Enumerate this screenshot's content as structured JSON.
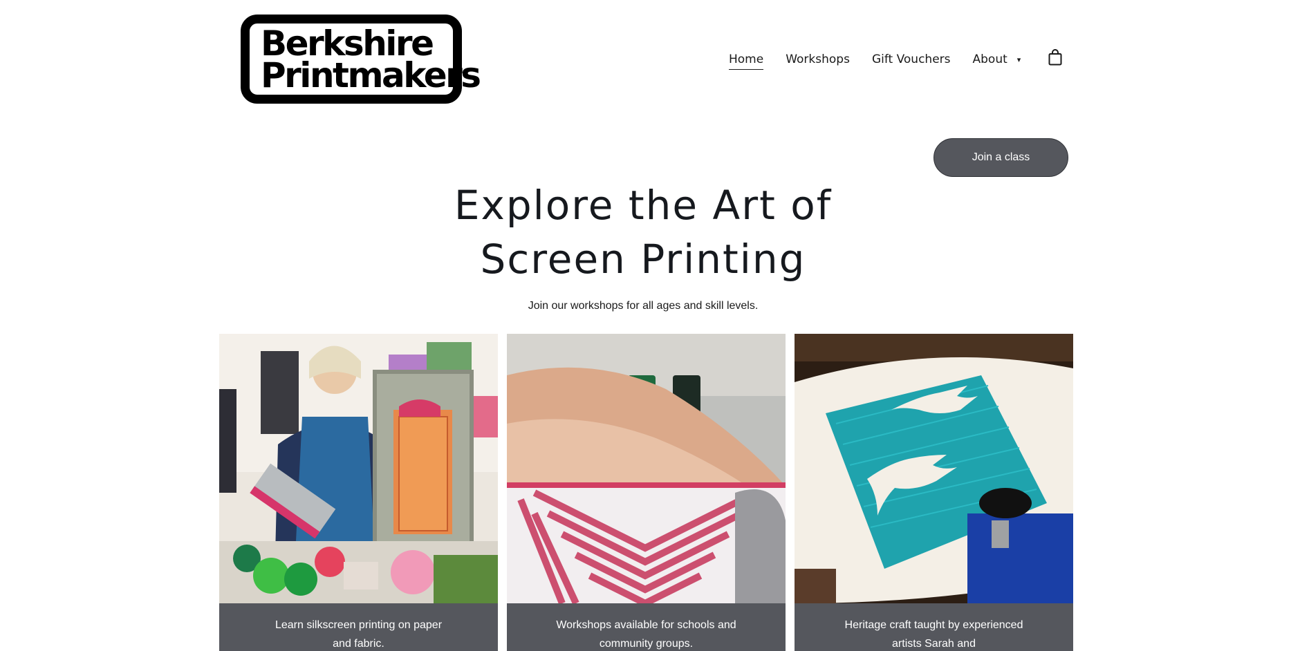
{
  "header": {
    "logo_line1": "Berkshire",
    "logo_line2": "Printmakers",
    "nav": [
      {
        "label": "Home",
        "active": true
      },
      {
        "label": "Workshops"
      },
      {
        "label": "Gift Vouchers"
      },
      {
        "label": "About"
      }
    ],
    "about_caret": "▾",
    "cart_icon": "shopping-bag-icon"
  },
  "cta": {
    "label": "Join a class"
  },
  "hero": {
    "title_line1": "Explore the Art of",
    "title_line2": "Screen Printing",
    "subtitle": "Join our workshops for all ages and skill levels."
  },
  "cards": [
    {
      "caption": "Learn silkscreen printing on paper and fabric."
    },
    {
      "caption": "Workshops available for schools and community groups."
    },
    {
      "caption": "Heritage craft taught by experienced artists Sarah and"
    }
  ],
  "colors": {
    "button_bg": "#55575d",
    "caption_bg": "#55575d",
    "text": "#16191e"
  }
}
